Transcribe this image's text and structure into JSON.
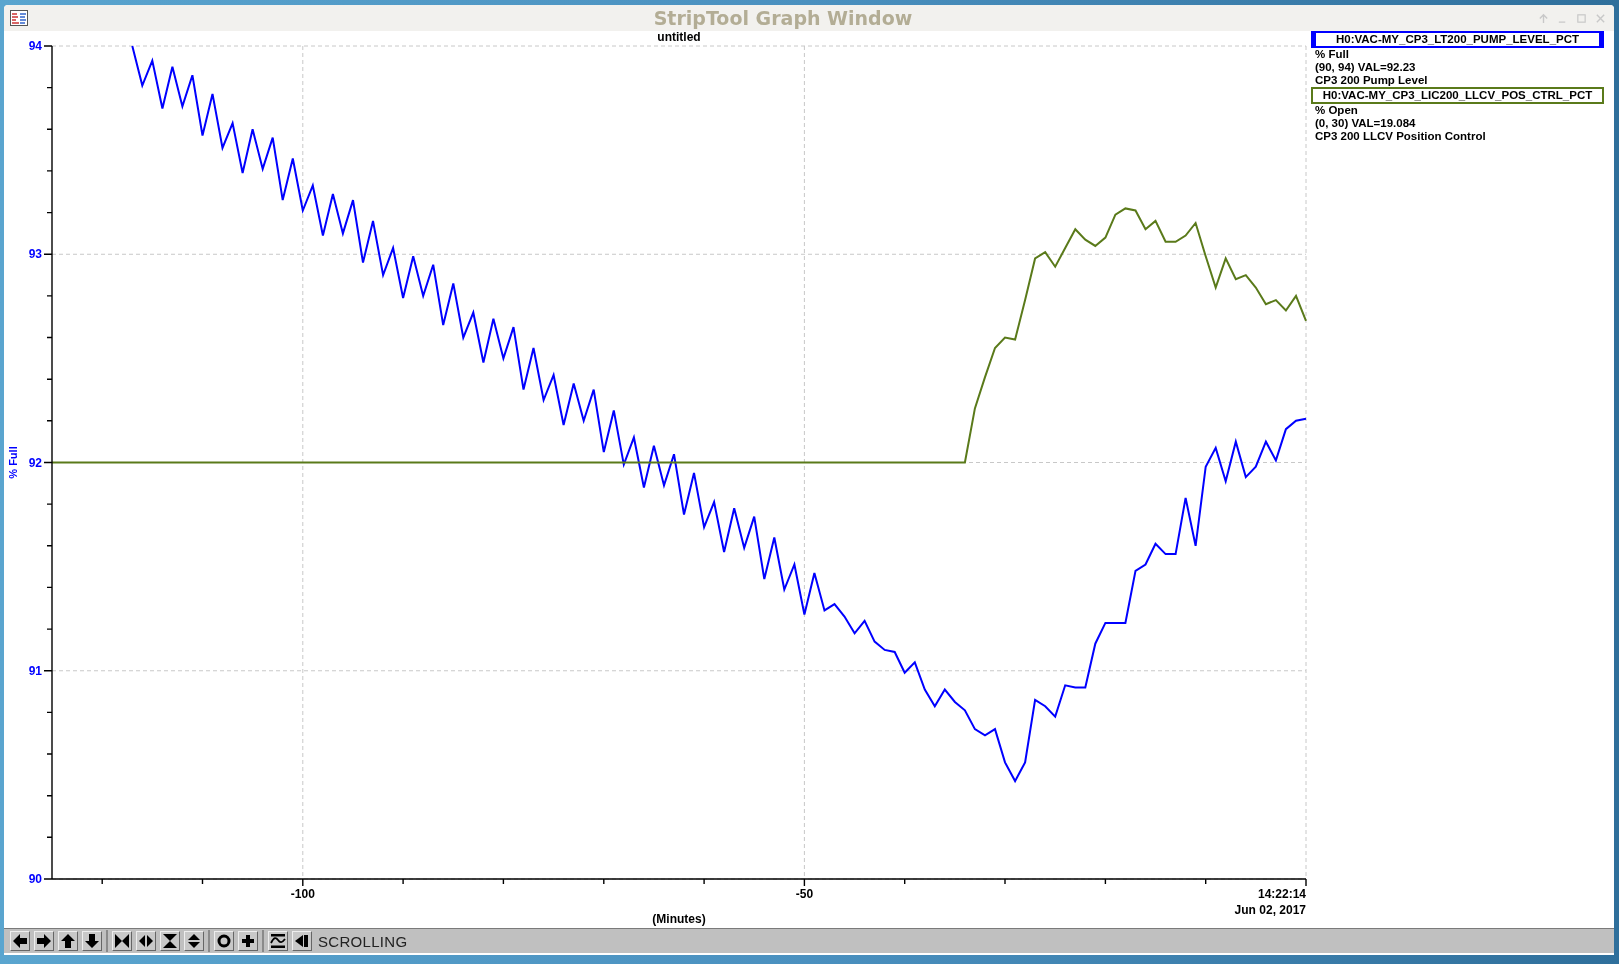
{
  "window": {
    "title": "StripTool Graph Window"
  },
  "plot": {
    "time_label": "14:22:14",
    "date_label": "Jun 02, 2017",
    "chart_data": {
      "type": "line",
      "title": "untitled",
      "xlabel": "(Minutes)",
      "ylabel": "% Full",
      "xlim": [
        -125,
        0
      ],
      "ylim": [
        90,
        94
      ],
      "grid": true,
      "xticks": [
        -100,
        -50
      ],
      "yticks": [
        90,
        91,
        92,
        93,
        94
      ],
      "x": [
        -125,
        -124,
        -123,
        -122,
        -121,
        -120,
        -119,
        -118,
        -117,
        -116,
        -115,
        -114,
        -113,
        -112,
        -111,
        -110,
        -109,
        -108,
        -107,
        -106,
        -105,
        -104,
        -103,
        -102,
        -101,
        -100,
        -99,
        -98,
        -97,
        -96,
        -95,
        -94,
        -93,
        -92,
        -91,
        -90,
        -89,
        -88,
        -87,
        -86,
        -85,
        -84,
        -83,
        -82,
        -81,
        -80,
        -79,
        -78,
        -77,
        -76,
        -75,
        -74,
        -73,
        -72,
        -71,
        -70,
        -69,
        -68,
        -67,
        -66,
        -65,
        -64,
        -63,
        -62,
        -61,
        -60,
        -59,
        -58,
        -57,
        -56,
        -55,
        -54,
        -53,
        -52,
        -51,
        -50,
        -49,
        -48,
        -47,
        -46,
        -45,
        -44,
        -43,
        -42,
        -41,
        -40,
        -39,
        -38,
        -37,
        -36,
        -35,
        -34,
        -33,
        -32,
        -31,
        -30,
        -29,
        -28,
        -27,
        -26,
        -25,
        -24,
        -23,
        -22,
        -21,
        -20,
        -19,
        -18,
        -17,
        -16,
        -15,
        -14,
        -13,
        -12,
        -11,
        -10,
        -9,
        -8,
        -7,
        -6,
        -5,
        -4,
        -3,
        -2,
        -1,
        0
      ],
      "series": [
        {
          "name": "H0:VAC-MY_CP3_LT200_PUMP_LEVEL_PCT",
          "color": "#0000ff",
          "values": [
            null,
            null,
            null,
            null,
            null,
            null,
            null,
            null,
            94.0,
            93.81,
            93.93,
            93.7,
            93.9,
            93.71,
            93.86,
            93.57,
            93.77,
            93.51,
            93.63,
            93.39,
            93.6,
            93.41,
            93.56,
            93.26,
            93.46,
            93.21,
            93.33,
            93.09,
            93.29,
            93.1,
            93.26,
            92.96,
            93.16,
            92.9,
            93.03,
            92.79,
            92.99,
            92.8,
            92.95,
            92.66,
            92.86,
            92.6,
            92.72,
            92.48,
            92.69,
            92.5,
            92.65,
            92.35,
            92.55,
            92.3,
            92.42,
            92.18,
            92.38,
            92.2,
            92.35,
            92.05,
            92.25,
            91.99,
            92.12,
            91.88,
            92.08,
            91.89,
            92.04,
            91.75,
            91.95,
            91.69,
            91.81,
            91.57,
            91.78,
            91.59,
            91.74,
            91.44,
            91.64,
            91.39,
            91.51,
            91.27,
            91.47,
            91.29,
            91.32,
            91.26,
            91.18,
            91.24,
            91.14,
            91.1,
            91.09,
            90.99,
            91.04,
            90.91,
            90.83,
            90.91,
            90.85,
            90.81,
            90.72,
            90.69,
            90.72,
            90.56,
            90.47,
            90.56,
            90.86,
            90.83,
            90.78,
            90.93,
            90.92,
            90.92,
            91.13,
            91.23,
            91.23,
            91.23,
            91.48,
            91.51,
            91.61,
            91.56,
            91.56,
            91.83,
            91.6,
            91.98,
            92.07,
            91.91,
            92.1,
            91.93,
            91.98,
            92.1,
            92.01,
            92.16,
            92.2,
            92.21
          ]
        },
        {
          "name": "H0:VAC-MY_CP3_LIC200_LLCV_POS_CTRL_PCT",
          "color": "#5a7a1a",
          "values": [
            92,
            92,
            92,
            92,
            92,
            92,
            92,
            92,
            92,
            92,
            92,
            92,
            92,
            92,
            92,
            92,
            92,
            92,
            92,
            92,
            92,
            92,
            92,
            92,
            92,
            92,
            92,
            92,
            92,
            92,
            92,
            92,
            92,
            92,
            92,
            92,
            92,
            92,
            92,
            92,
            92,
            92,
            92,
            92,
            92,
            92,
            92,
            92,
            92,
            92,
            92,
            92,
            92,
            92,
            92,
            92,
            92,
            92,
            92,
            92,
            92,
            92,
            92,
            92,
            92,
            92,
            92,
            92,
            92,
            92,
            92,
            92,
            92,
            92,
            92,
            92,
            92,
            92,
            92,
            92,
            92,
            92,
            92,
            92,
            92,
            92,
            92,
            92,
            92,
            92,
            92,
            92,
            92.26,
            92.41,
            92.55,
            92.6,
            92.59,
            92.78,
            92.98,
            93.01,
            92.94,
            93.03,
            93.12,
            93.07,
            93.04,
            93.08,
            93.19,
            93.22,
            93.21,
            93.12,
            93.16,
            93.06,
            93.06,
            93.09,
            93.15,
            92.99,
            92.84,
            92.98,
            92.88,
            92.9,
            92.84,
            92.76,
            92.78,
            92.73,
            92.8,
            92.68
          ]
        }
      ]
    }
  },
  "legend": [
    {
      "selected": true,
      "units": "% Full",
      "range": "(90, 94) VAL=92.23",
      "description": "CP3 200 Pump Level"
    },
    {
      "selected": false,
      "units": "% Open",
      "range": "(0, 30) VAL=19.084",
      "description": "CP3 200 LLCV Position Control"
    }
  ],
  "toolbar": {
    "mode": "SCROLLING"
  }
}
